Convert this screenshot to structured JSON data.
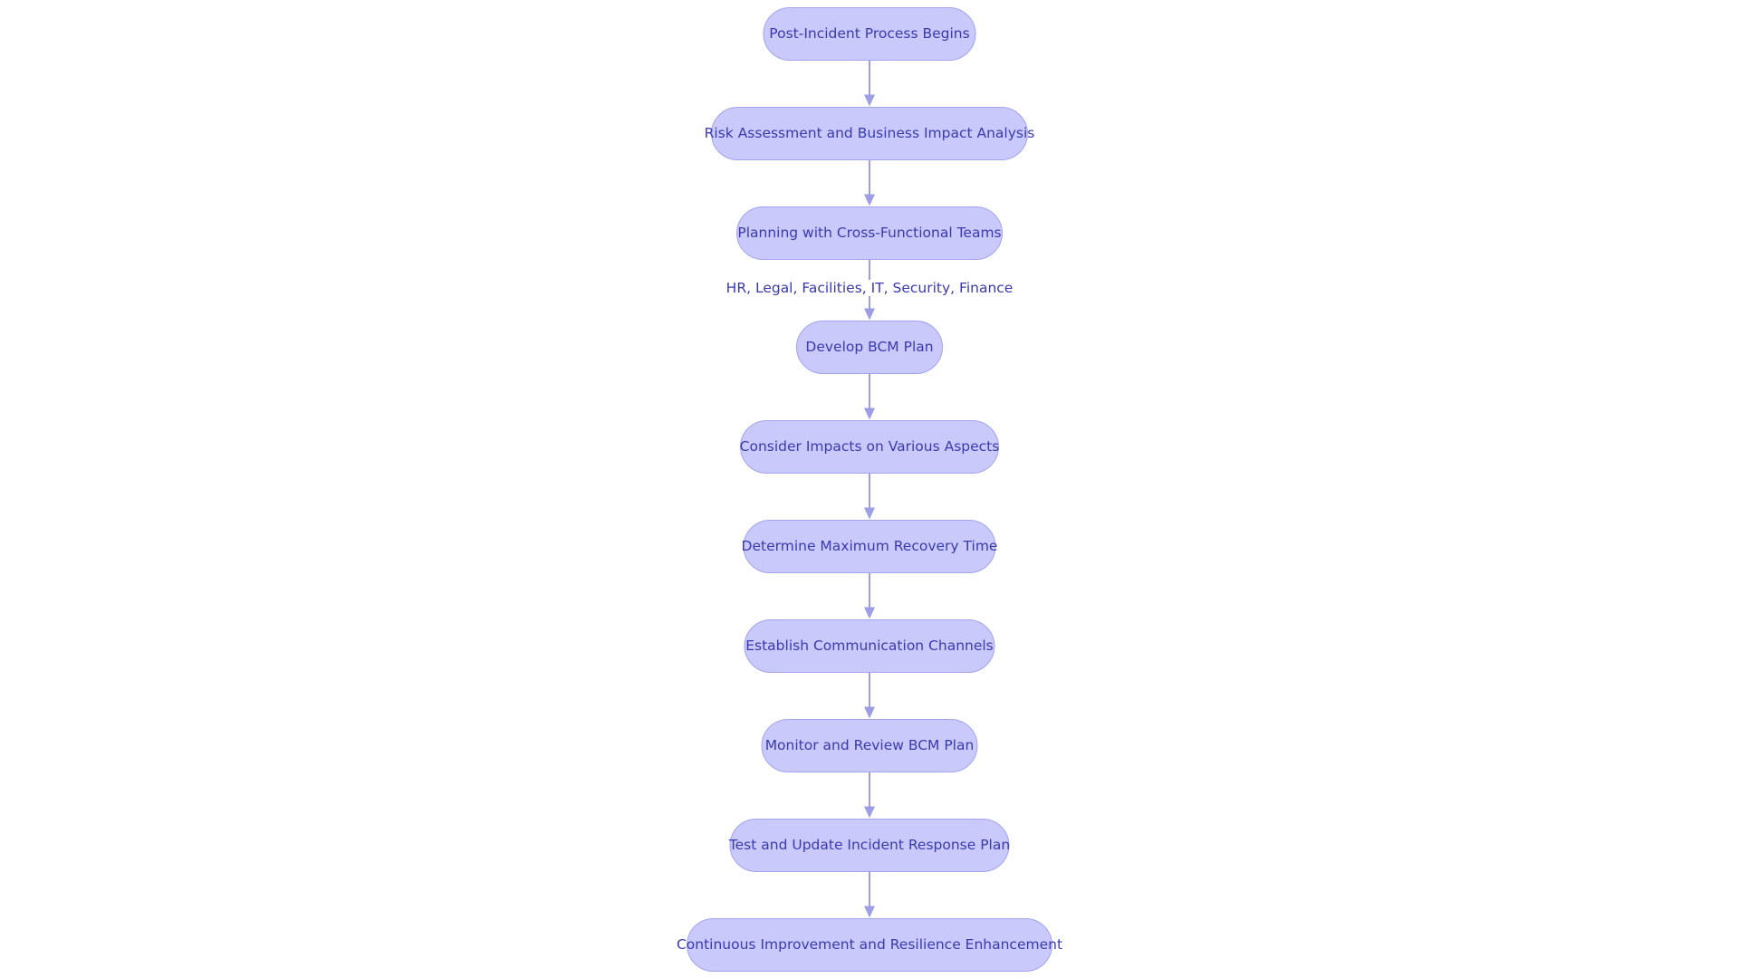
{
  "diagram": {
    "type": "flowchart",
    "direction": "top-down",
    "colors": {
      "node_fill": "#c9c9fb",
      "node_stroke": "#a3a3ee",
      "text": "#3a3aae",
      "edge": "#9d9de6"
    },
    "nodes": [
      {
        "id": "n1",
        "label": "Post-Incident Process Begins"
      },
      {
        "id": "n2",
        "label": "Risk Assessment and Business Impact Analysis"
      },
      {
        "id": "n3",
        "label": "Planning with Cross-Functional Teams"
      },
      {
        "id": "n4",
        "label": "Develop BCM Plan"
      },
      {
        "id": "n5",
        "label": "Consider Impacts on Various Aspects"
      },
      {
        "id": "n6",
        "label": "Determine Maximum Recovery Time"
      },
      {
        "id": "n7",
        "label": "Establish Communication Channels"
      },
      {
        "id": "n8",
        "label": "Monitor and Review BCM Plan"
      },
      {
        "id": "n9",
        "label": "Test and Update Incident Response Plan"
      },
      {
        "id": "n10",
        "label": "Continuous Improvement and Resilience Enhancement"
      }
    ],
    "edges": [
      {
        "from": "n1",
        "to": "n2",
        "label": ""
      },
      {
        "from": "n2",
        "to": "n3",
        "label": ""
      },
      {
        "from": "n3",
        "to": "n4",
        "label": "HR, Legal, Facilities, IT, Security, Finance"
      },
      {
        "from": "n4",
        "to": "n5",
        "label": ""
      },
      {
        "from": "n5",
        "to": "n6",
        "label": ""
      },
      {
        "from": "n6",
        "to": "n7",
        "label": ""
      },
      {
        "from": "n7",
        "to": "n8",
        "label": ""
      },
      {
        "from": "n8",
        "to": "n9",
        "label": ""
      },
      {
        "from": "n9",
        "to": "n10",
        "label": ""
      }
    ]
  }
}
